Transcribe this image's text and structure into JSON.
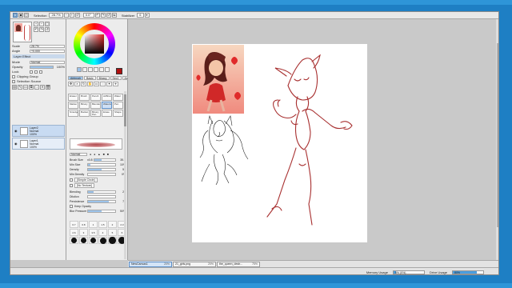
{
  "toolbar": {
    "selection_label": "Selection",
    "zoom": "28.7%",
    "angle": "0.0°",
    "stabilizer_label": "Stabilizer",
    "stabilizer_value": "6"
  },
  "navigator": {
    "scale_label": "Scale",
    "scale_value": "28.7%",
    "angle_label": "Angle",
    "angle_value": "+0.000"
  },
  "layer_panel": {
    "effect_header": "Layer Effect",
    "mode_label": "Mode",
    "mode_value": "Normal",
    "opacity_label": "Opacity",
    "opacity_value": "100%",
    "opacity_fraction": 1.0,
    "lock_label": "Lock",
    "clipping_label": "Clipping Group",
    "selection_source_label": "Selection Source",
    "layers": [
      {
        "name": "Layer2",
        "mode": "Normal",
        "opacity": "100%"
      },
      {
        "name": "Layer1",
        "mode": "Normal",
        "opacity": "100%"
      }
    ]
  },
  "color": {
    "current": "#b01010"
  },
  "tools": {
    "tabs": [
      "Airbrush",
      "Basic",
      "Binary",
      "Sec1",
      "Artistic"
    ],
    "brushes": [
      "Eraser",
      "Brush",
      "Pencil",
      "AirBrush",
      "Water",
      "Marker",
      "Binary",
      "Blender",
      "Watercolor",
      "Pen",
      "Smudge",
      "Bucket",
      "Binary Pen",
      "Erase",
      "Shape"
    ]
  },
  "brush_settings": {
    "mode": "Normal",
    "size_label": "Brush Size",
    "size_mult": "x0.8",
    "size_value": "35.0",
    "min_size_label": "Min Size",
    "min_size_value": "10%",
    "density_label": "Density",
    "density_value": "50",
    "min_density_label": "Min Density",
    "min_density_value": "0%",
    "shape_label": "[Simple Circle]",
    "texture_label": "[No Texture]",
    "blending_label": "Blending",
    "blending_value": "20",
    "dilution_label": "Dilution",
    "dilution_value": "0",
    "persistence_label": "Persistence",
    "persistence_value": "75",
    "keep_opacity_label": "Keep Opacity",
    "blur_label": "Blur Pressure",
    "blur_value": "50%",
    "size_presets": [
      "0.7",
      "0.8",
      "1",
      "1.5",
      "2",
      "2.3",
      "2.6",
      "3",
      "3.5",
      "4",
      "5",
      "6"
    ]
  },
  "file_tabs": [
    {
      "name": "NewCanvas1",
      "zoom": "20%"
    },
    {
      "name": "21_girls.png",
      "zoom": "20%"
    },
    {
      "name": "the_queen_destr...",
      "zoom": "75%"
    }
  ],
  "status": {
    "memory_label": "Memory Usage",
    "memory_value": "9% (9%)",
    "memory_fraction": 0.09,
    "drive_label": "Drive Usage",
    "drive_value": "80%",
    "drive_fraction": 0.8
  }
}
